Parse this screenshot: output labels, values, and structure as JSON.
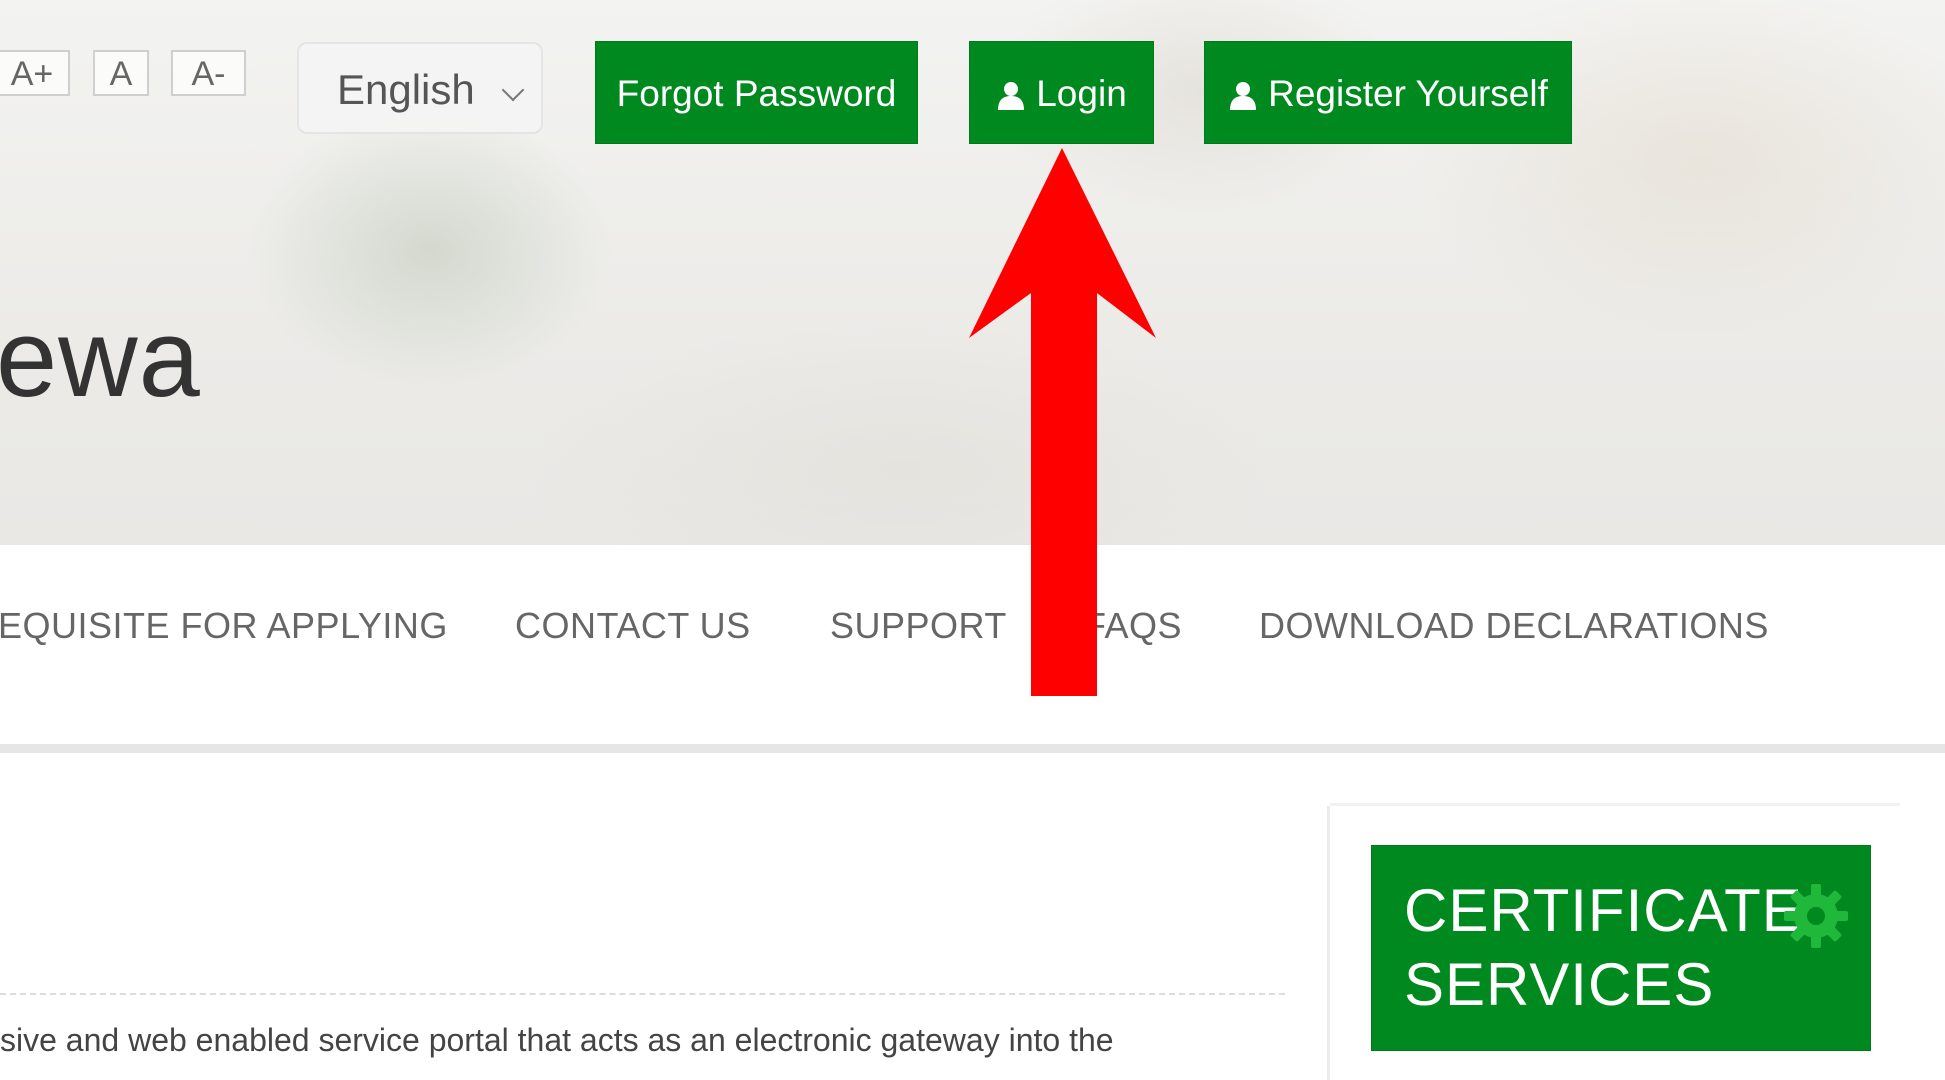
{
  "accessibility": {
    "increase_label": "A+",
    "normal_label": "A",
    "decrease_label": "A-"
  },
  "language": {
    "selected": "English"
  },
  "header_buttons": {
    "forgot_password": "Forgot Password",
    "login": "Login",
    "register": "Register Yourself"
  },
  "site_title_partial": "ewa",
  "nav": {
    "items": [
      "EQUISITE FOR APPLYING",
      "CONTACT US",
      "SUPPORT",
      "FAQS",
      "DOWNLOAD DECLARATIONS"
    ]
  },
  "intro_text_partial": "sive and web enabled service portal that acts as an electronic gateway into the",
  "certificate_services": {
    "line1": "CERTIFICATE",
    "line2": "SERVICES"
  },
  "colors": {
    "brand_green": "#00891f",
    "arrow_red": "#ff0000"
  },
  "icons": [
    "user-icon",
    "chevron-down-icon",
    "gear-icon",
    "arrow-up-icon"
  ]
}
